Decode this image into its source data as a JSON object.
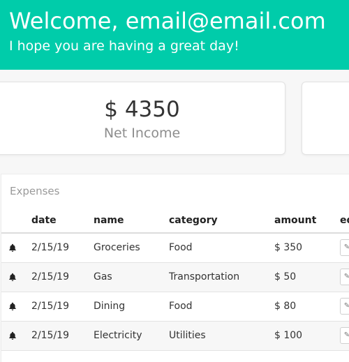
{
  "header": {
    "title": "Welcome, email@email.com",
    "subtitle": "I hope you are having a great day!"
  },
  "summary": {
    "net_income_amount": "$ 4350",
    "net_income_label": "Net Income"
  },
  "expenses": {
    "title": "Expenses",
    "columns": [
      "date",
      "name",
      "category",
      "amount",
      "edit"
    ],
    "rows": [
      {
        "date": "2/15/19",
        "name": "Groceries",
        "category": "Food",
        "amount": "$ 350"
      },
      {
        "date": "2/15/19",
        "name": "Gas",
        "category": "Transportation",
        "amount": "$ 50"
      },
      {
        "date": "2/15/19",
        "name": "Dining",
        "category": "Food",
        "amount": "$ 80"
      },
      {
        "date": "2/15/19",
        "name": "Electricity",
        "category": "Utilities",
        "amount": "$ 100"
      }
    ],
    "row_icon": "bell-icon",
    "edit_icon": "pencil-icon"
  },
  "colors": {
    "header_bg": "#00ccaa",
    "header_text": "#ffffff"
  }
}
